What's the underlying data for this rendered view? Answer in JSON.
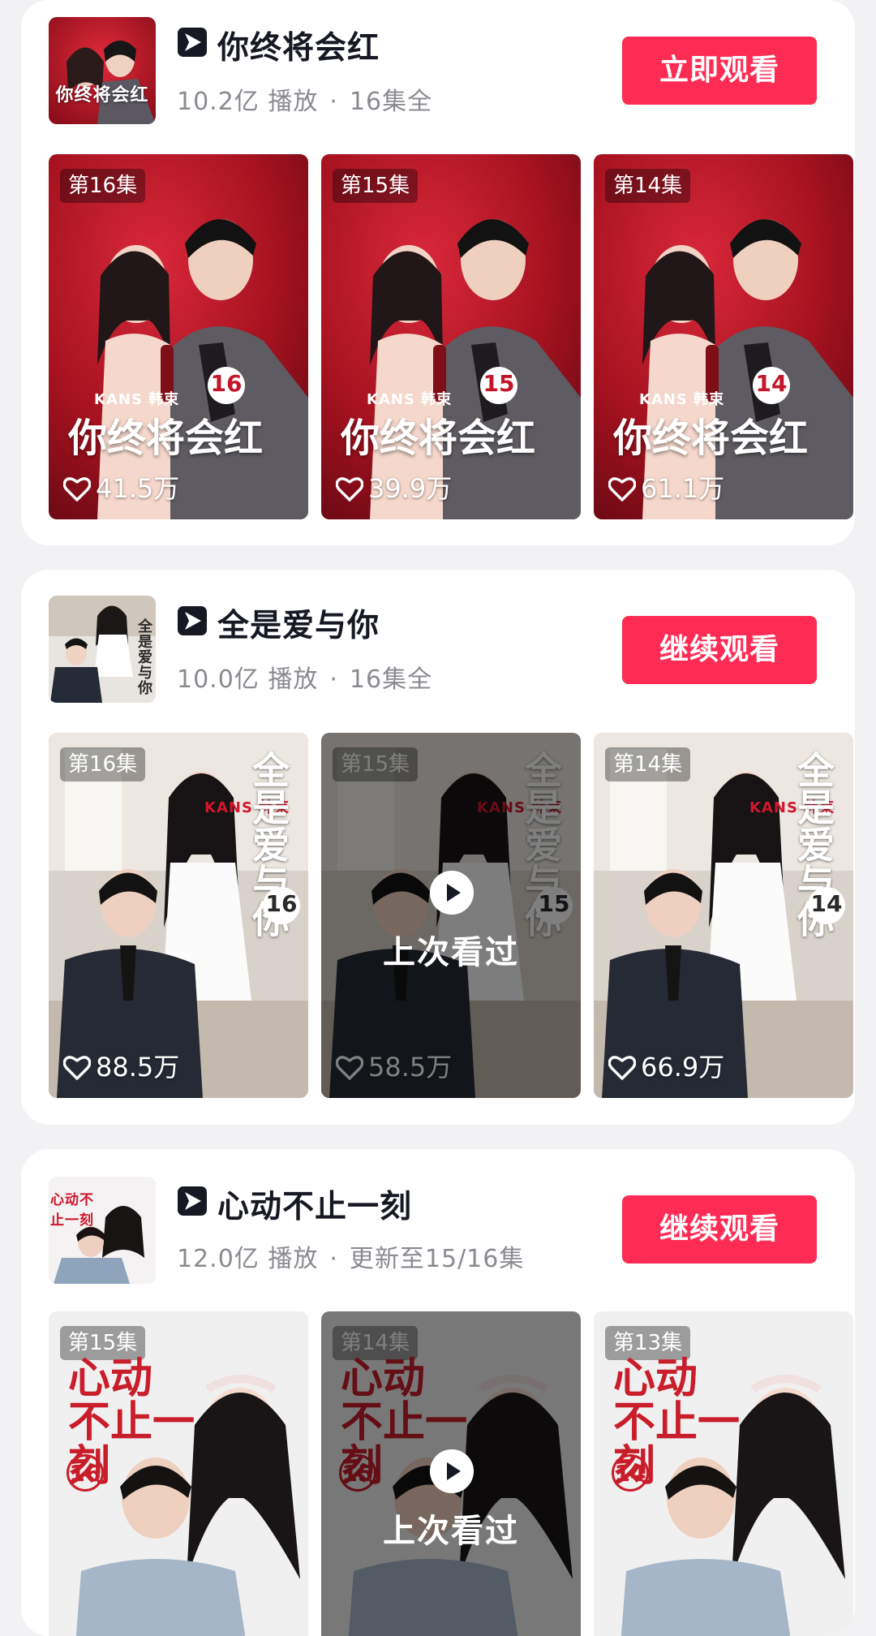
{
  "cards": [
    {
      "title": "你终将会红",
      "meta_plays": "10.2亿 播放",
      "meta_sep": "·",
      "meta_status": "16集全",
      "button_label": "立即观看",
      "thumb_caption": "你终将会红",
      "episodes": [
        {
          "badge": "第16集",
          "num": "16",
          "likes": "41.5万",
          "poster_title": "你终将会红",
          "brand": "KANS 韩束",
          "watched": false
        },
        {
          "badge": "第15集",
          "num": "15",
          "likes": "39.9万",
          "poster_title": "你终将会红",
          "brand": "KANS 韩束",
          "watched": false
        },
        {
          "badge": "第14集",
          "num": "14",
          "likes": "61.1万",
          "poster_title": "你终将会红",
          "brand": "KANS 韩束",
          "watched": false
        }
      ]
    },
    {
      "title": "全是爱与你",
      "meta_plays": "10.0亿 播放",
      "meta_sep": "·",
      "meta_status": "16集全",
      "button_label": "继续观看",
      "thumb_caption": "全是爱与你",
      "episodes": [
        {
          "badge": "第16集",
          "num": "16",
          "likes": "88.5万",
          "poster_title": "全是爱与你",
          "brand": "KANS 韩束",
          "watched": false
        },
        {
          "badge": "第15集",
          "num": "15",
          "likes": "58.5万",
          "poster_title": "全是爱与你",
          "brand": "KANS 韩束",
          "watched": true
        },
        {
          "badge": "第14集",
          "num": "14",
          "likes": "66.9万",
          "poster_title": "全是爱与你",
          "brand": "KANS 韩束",
          "watched": false
        }
      ]
    },
    {
      "title": "心动不止一刻",
      "meta_plays": "12.0亿 播放",
      "meta_sep": "·",
      "meta_status": "更新至15/16集",
      "button_label": "继续观看",
      "thumb_caption": "心动不止一刻",
      "episodes": [
        {
          "badge": "第15集",
          "num": "16",
          "likes": "",
          "poster_title": "心动 不止一刻",
          "brand": "",
          "watched": false
        },
        {
          "badge": "第14集",
          "num": "15",
          "likes": "",
          "poster_title": "心动 不止一刻",
          "brand": "",
          "watched": true
        },
        {
          "badge": "第13集",
          "num": "14",
          "likes": "",
          "poster_title": "心动 不止一刻",
          "brand": "",
          "watched": false
        }
      ]
    }
  ],
  "watched_label": "上次看过",
  "colors": {
    "accent": "#fe2c55",
    "card_bg": "#ffffff",
    "page_bg": "#f2f2f4",
    "meta_text": "#8a8b91"
  },
  "icons": {
    "drama": "drama-play-logo-icon",
    "like": "heart-outline-icon",
    "watched": "play-circle-icon"
  }
}
